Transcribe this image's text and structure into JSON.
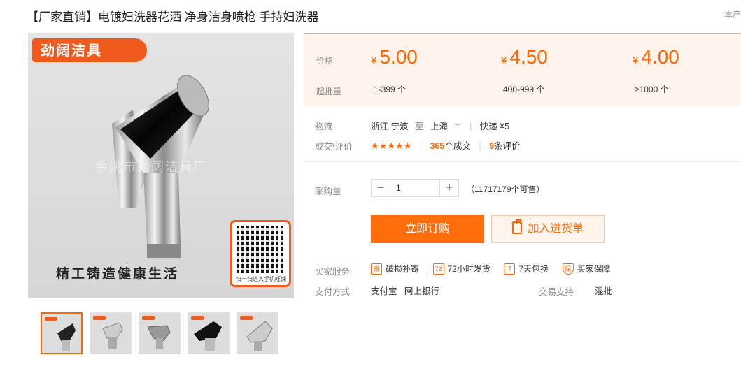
{
  "title": "【厂家直销】电镀妇洗器花洒 净身洁身喷枪 手持妇洗器",
  "corner_text": "本产",
  "gallery": {
    "brand": "劲阔洁具",
    "watermark": "余姚市劲阔洁具厂",
    "slogan": "精工铸造健康生活",
    "qr_caption": "扫一扫进入手机旺铺"
  },
  "pricing": {
    "price_label": "价格",
    "qty_label": "起批量",
    "currency": "¥",
    "tiers": [
      {
        "price": "5.00",
        "qty": "1-399 个"
      },
      {
        "price": "4.50",
        "qty": "400-999 个"
      },
      {
        "price": "4.00",
        "qty": "≥1000 个"
      }
    ]
  },
  "logistics": {
    "label": "物流",
    "from": "浙江 宁波",
    "to_word": "至",
    "to": "上海",
    "shipping": "快递 ¥5"
  },
  "deals": {
    "label": "成交\\评价",
    "stars": "★★★★★",
    "rating": 5,
    "count": "365",
    "count_suffix": "个成交",
    "reviews": "9",
    "reviews_suffix": "条评价"
  },
  "purchase": {
    "label": "采购量",
    "minus": "−",
    "quantity": "1",
    "plus": "+",
    "stock": "（11717179个可售）"
  },
  "actions": {
    "buy": "立即订购",
    "cart": "加入进货单"
  },
  "services": {
    "label": "买家服务",
    "items": [
      {
        "icon": "寄",
        "text": "破损补寄"
      },
      {
        "icon": "72",
        "text": "72小时发货"
      },
      {
        "icon": "7",
        "text": "7天包换"
      },
      {
        "icon": "保",
        "text": "买家保障"
      }
    ]
  },
  "payment": {
    "label": "支付方式",
    "methods": "支付宝   网上银行",
    "trade_label": "交易支持",
    "trade_value": "混批"
  },
  "colors": {
    "accent": "#ff6600",
    "price_bg": "#fff3eb"
  }
}
